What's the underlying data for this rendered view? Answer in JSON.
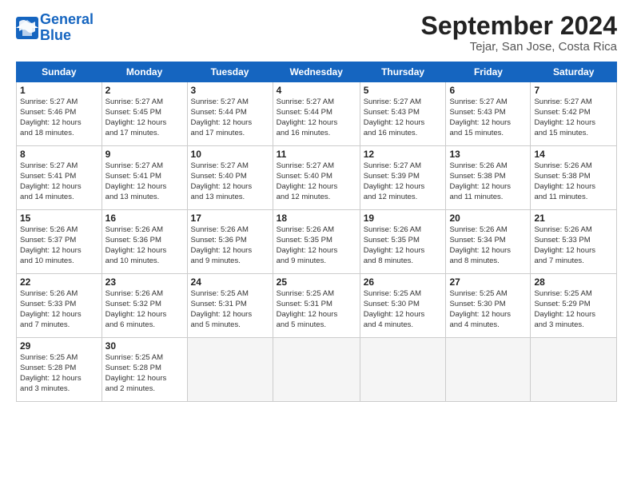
{
  "logo": {
    "line1": "General",
    "line2": "Blue"
  },
  "title": "September 2024",
  "subtitle": "Tejar, San Jose, Costa Rica",
  "weekdays": [
    "Sunday",
    "Monday",
    "Tuesday",
    "Wednesday",
    "Thursday",
    "Friday",
    "Saturday"
  ],
  "weeks": [
    [
      {
        "day": "1",
        "info": "Sunrise: 5:27 AM\nSunset: 5:46 PM\nDaylight: 12 hours\nand 18 minutes."
      },
      {
        "day": "2",
        "info": "Sunrise: 5:27 AM\nSunset: 5:45 PM\nDaylight: 12 hours\nand 17 minutes."
      },
      {
        "day": "3",
        "info": "Sunrise: 5:27 AM\nSunset: 5:44 PM\nDaylight: 12 hours\nand 17 minutes."
      },
      {
        "day": "4",
        "info": "Sunrise: 5:27 AM\nSunset: 5:44 PM\nDaylight: 12 hours\nand 16 minutes."
      },
      {
        "day": "5",
        "info": "Sunrise: 5:27 AM\nSunset: 5:43 PM\nDaylight: 12 hours\nand 16 minutes."
      },
      {
        "day": "6",
        "info": "Sunrise: 5:27 AM\nSunset: 5:43 PM\nDaylight: 12 hours\nand 15 minutes."
      },
      {
        "day": "7",
        "info": "Sunrise: 5:27 AM\nSunset: 5:42 PM\nDaylight: 12 hours\nand 15 minutes."
      }
    ],
    [
      {
        "day": "8",
        "info": "Sunrise: 5:27 AM\nSunset: 5:41 PM\nDaylight: 12 hours\nand 14 minutes."
      },
      {
        "day": "9",
        "info": "Sunrise: 5:27 AM\nSunset: 5:41 PM\nDaylight: 12 hours\nand 13 minutes."
      },
      {
        "day": "10",
        "info": "Sunrise: 5:27 AM\nSunset: 5:40 PM\nDaylight: 12 hours\nand 13 minutes."
      },
      {
        "day": "11",
        "info": "Sunrise: 5:27 AM\nSunset: 5:40 PM\nDaylight: 12 hours\nand 12 minutes."
      },
      {
        "day": "12",
        "info": "Sunrise: 5:27 AM\nSunset: 5:39 PM\nDaylight: 12 hours\nand 12 minutes."
      },
      {
        "day": "13",
        "info": "Sunrise: 5:26 AM\nSunset: 5:38 PM\nDaylight: 12 hours\nand 11 minutes."
      },
      {
        "day": "14",
        "info": "Sunrise: 5:26 AM\nSunset: 5:38 PM\nDaylight: 12 hours\nand 11 minutes."
      }
    ],
    [
      {
        "day": "15",
        "info": "Sunrise: 5:26 AM\nSunset: 5:37 PM\nDaylight: 12 hours\nand 10 minutes."
      },
      {
        "day": "16",
        "info": "Sunrise: 5:26 AM\nSunset: 5:36 PM\nDaylight: 12 hours\nand 10 minutes."
      },
      {
        "day": "17",
        "info": "Sunrise: 5:26 AM\nSunset: 5:36 PM\nDaylight: 12 hours\nand 9 minutes."
      },
      {
        "day": "18",
        "info": "Sunrise: 5:26 AM\nSunset: 5:35 PM\nDaylight: 12 hours\nand 9 minutes."
      },
      {
        "day": "19",
        "info": "Sunrise: 5:26 AM\nSunset: 5:35 PM\nDaylight: 12 hours\nand 8 minutes."
      },
      {
        "day": "20",
        "info": "Sunrise: 5:26 AM\nSunset: 5:34 PM\nDaylight: 12 hours\nand 8 minutes."
      },
      {
        "day": "21",
        "info": "Sunrise: 5:26 AM\nSunset: 5:33 PM\nDaylight: 12 hours\nand 7 minutes."
      }
    ],
    [
      {
        "day": "22",
        "info": "Sunrise: 5:26 AM\nSunset: 5:33 PM\nDaylight: 12 hours\nand 7 minutes."
      },
      {
        "day": "23",
        "info": "Sunrise: 5:26 AM\nSunset: 5:32 PM\nDaylight: 12 hours\nand 6 minutes."
      },
      {
        "day": "24",
        "info": "Sunrise: 5:25 AM\nSunset: 5:31 PM\nDaylight: 12 hours\nand 5 minutes."
      },
      {
        "day": "25",
        "info": "Sunrise: 5:25 AM\nSunset: 5:31 PM\nDaylight: 12 hours\nand 5 minutes."
      },
      {
        "day": "26",
        "info": "Sunrise: 5:25 AM\nSunset: 5:30 PM\nDaylight: 12 hours\nand 4 minutes."
      },
      {
        "day": "27",
        "info": "Sunrise: 5:25 AM\nSunset: 5:30 PM\nDaylight: 12 hours\nand 4 minutes."
      },
      {
        "day": "28",
        "info": "Sunrise: 5:25 AM\nSunset: 5:29 PM\nDaylight: 12 hours\nand 3 minutes."
      }
    ],
    [
      {
        "day": "29",
        "info": "Sunrise: 5:25 AM\nSunset: 5:28 PM\nDaylight: 12 hours\nand 3 minutes."
      },
      {
        "day": "30",
        "info": "Sunrise: 5:25 AM\nSunset: 5:28 PM\nDaylight: 12 hours\nand 2 minutes."
      },
      {
        "day": "",
        "info": ""
      },
      {
        "day": "",
        "info": ""
      },
      {
        "day": "",
        "info": ""
      },
      {
        "day": "",
        "info": ""
      },
      {
        "day": "",
        "info": ""
      }
    ]
  ]
}
